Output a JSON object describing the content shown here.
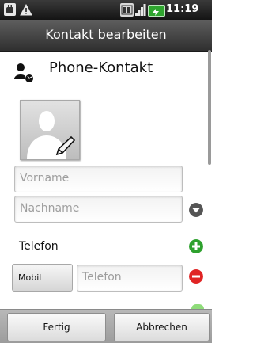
{
  "status_bar": {
    "time": "11:19"
  },
  "title_bar": {
    "title": "Kontakt bearbeiten"
  },
  "account": {
    "label": "Phone-Kontakt"
  },
  "fields": {
    "first_name_placeholder": "Vorname",
    "last_name_placeholder": "Nachname"
  },
  "phone_section": {
    "label": "Telefon",
    "type_label": "Mobil",
    "number_placeholder": "Telefon"
  },
  "bottom_bar": {
    "done_label": "Fertig",
    "cancel_label": "Abbrechen"
  },
  "colors": {
    "add_green": "#2ea12e",
    "remove_red": "#e02424",
    "expand_gray": "#555555",
    "battery_green": "#2fa52f"
  }
}
